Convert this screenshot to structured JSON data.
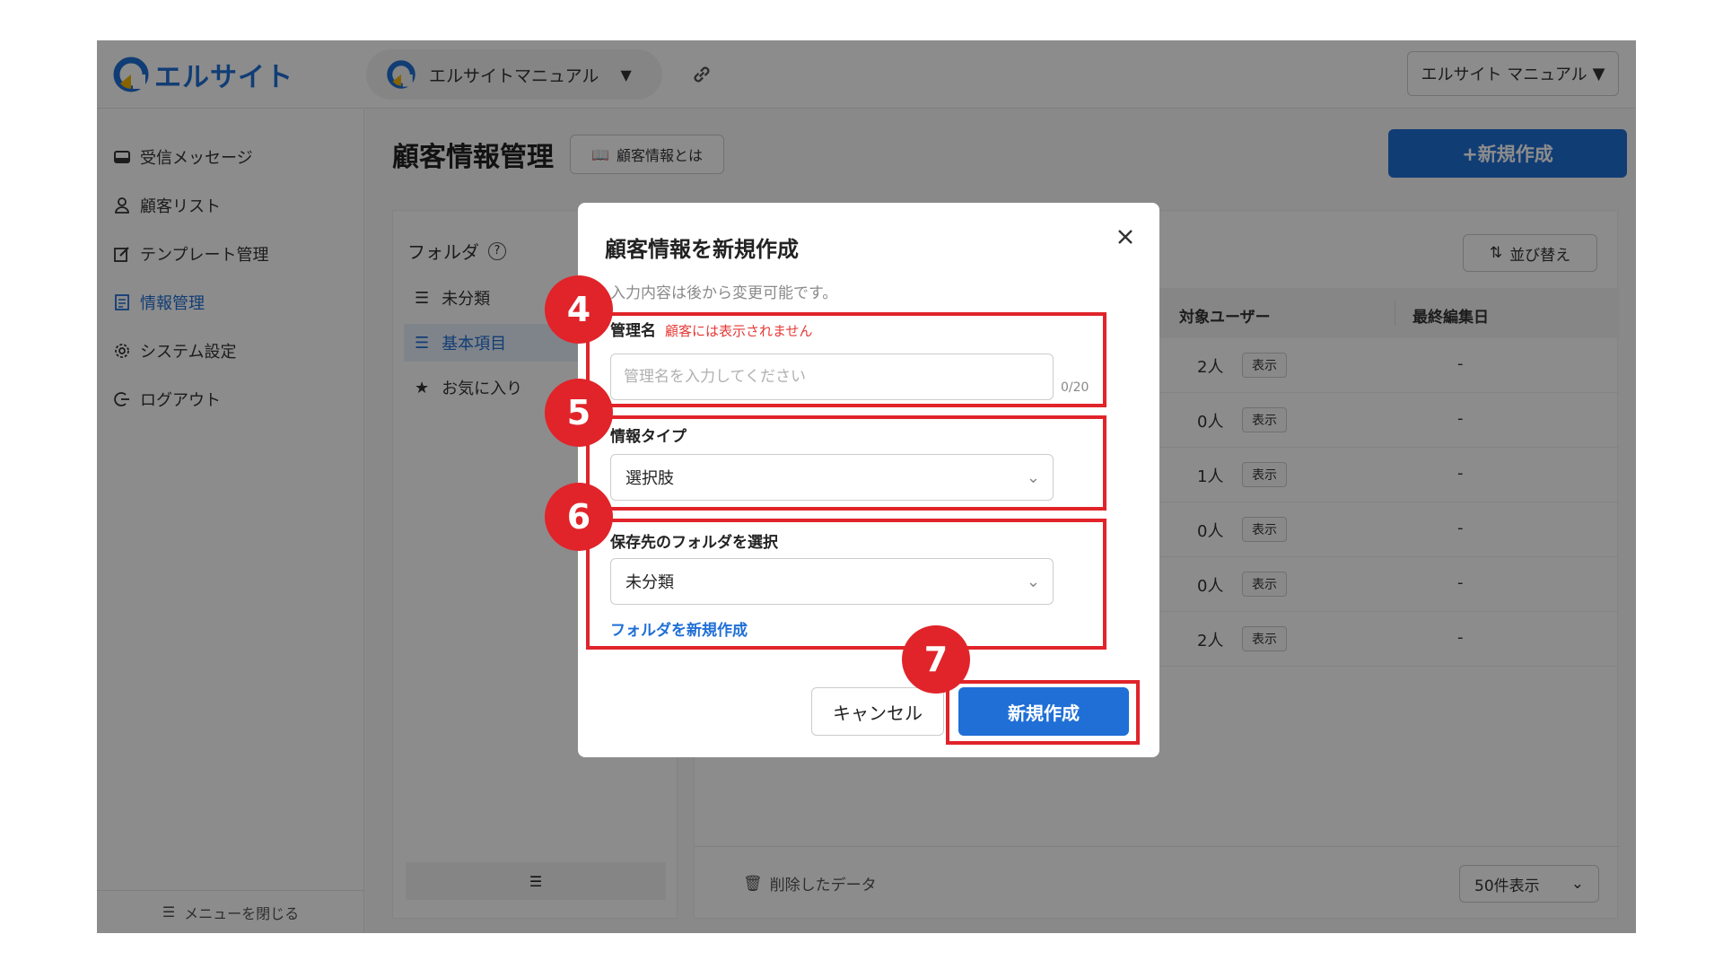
{
  "brand": {
    "name": "エルサイト",
    "color": "#1f6fd6"
  },
  "header": {
    "workspace": "エルサイトマニュアル",
    "account": "エルサイト マニュアル"
  },
  "sidebar": {
    "items": [
      {
        "label": "受信メッセージ",
        "icon": "inbox-icon"
      },
      {
        "label": "顧客リスト",
        "icon": "user-icon"
      },
      {
        "label": "テンプレート管理",
        "icon": "edit-icon"
      },
      {
        "label": "情報管理",
        "icon": "document-icon",
        "active": true
      },
      {
        "label": "システム設定",
        "icon": "gear-icon"
      },
      {
        "label": "ログアウト",
        "icon": "logout-icon"
      }
    ],
    "close_menu": "メニューを閉じる"
  },
  "main": {
    "title": "顧客情報管理",
    "info_button": "顧客情報とは",
    "create_button": "+新規作成",
    "folders": {
      "title": "フォルダ",
      "items": [
        {
          "label": "未分類",
          "icon": "list-icon"
        },
        {
          "label": "基本項目",
          "icon": "list-icon",
          "active": true
        },
        {
          "label": "お気に入り",
          "icon": "star-icon"
        }
      ]
    },
    "table": {
      "sort_button": "並び替え",
      "headers": [
        "対象ユーザー",
        "最終編集日"
      ],
      "rows": [
        {
          "count": "2人",
          "tag": "表示",
          "date": "-"
        },
        {
          "count": "0人",
          "tag": "表示",
          "date": "-"
        },
        {
          "count": "1人",
          "tag": "表示",
          "date": "-"
        },
        {
          "count": "0人",
          "tag": "表示",
          "date": "-"
        },
        {
          "count": "0人",
          "tag": "表示",
          "date": "-"
        },
        {
          "count": "2人",
          "tag": "表示",
          "date": "-"
        }
      ],
      "deleted_data": "削除したデータ",
      "per_page": "50件表示"
    }
  },
  "modal": {
    "title": "顧客情報を新規作成",
    "subtitle": "入力内容は後から変更可能です。",
    "name_label": "管理名",
    "name_note": "顧客には表示されません",
    "name_placeholder": "管理名を入力してください",
    "name_value": "",
    "name_counter": "0/20",
    "type_label": "情報タイプ",
    "type_value": "選択肢",
    "folder_label": "保存先のフォルダを選択",
    "folder_value": "未分類",
    "new_folder_link": "フォルダを新規作成",
    "cancel": "キャンセル",
    "submit": "新規作成"
  },
  "callouts": [
    "4",
    "5",
    "6",
    "7"
  ],
  "callout_color": "#e0242a"
}
